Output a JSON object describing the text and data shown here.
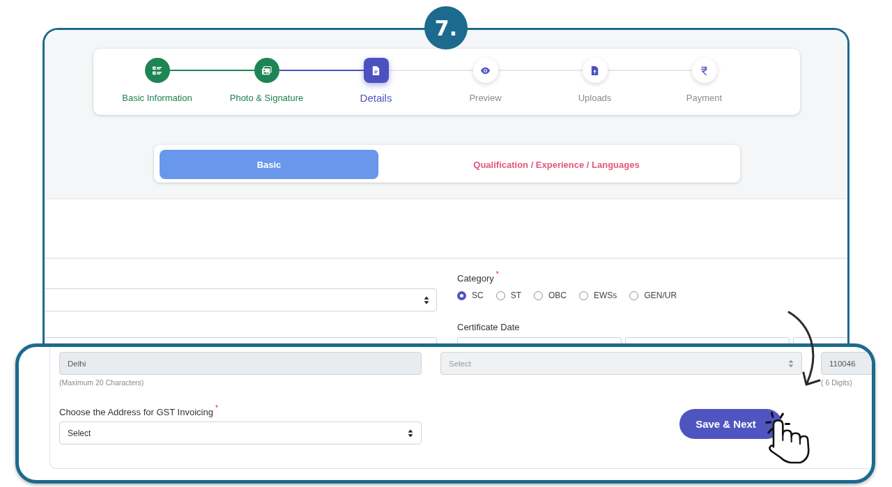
{
  "badge": {
    "label": "7."
  },
  "steps": [
    {
      "label": "Basic Information",
      "completed": true,
      "selected": false
    },
    {
      "label": "Photo & Signature",
      "completed": true,
      "selected": false
    },
    {
      "label": "Details",
      "completed": false,
      "selected": true
    },
    {
      "label": "Preview",
      "completed": false,
      "selected": false
    },
    {
      "label": "Uploads",
      "completed": false,
      "selected": false
    },
    {
      "label": "Payment",
      "completed": false,
      "selected": false
    }
  ],
  "tabs": [
    {
      "label": "Basic",
      "selected": true
    },
    {
      "label": "Qualification / Experience / Languages",
      "selected": false
    }
  ],
  "form": {
    "left_fields": [
      {
        "kind": "select"
      },
      {
        "kind": "input"
      }
    ],
    "category": {
      "label": "Category",
      "required_mark": "*",
      "options": [
        {
          "label": "SC",
          "selected": true
        },
        {
          "label": "ST",
          "selected": false
        },
        {
          "label": "OBC",
          "selected": false
        },
        {
          "label": "EWSs",
          "selected": false
        },
        {
          "label": "GEN/UR",
          "selected": false
        }
      ]
    },
    "certificate_date": {
      "label": "Certificate Date",
      "inputs": [
        {
          "kind": "input"
        },
        {
          "kind": "input"
        },
        {
          "kind": "input"
        }
      ]
    }
  },
  "zoom_panel": {
    "address_fields": [
      {
        "kind": "input",
        "value": "Delhi",
        "disabled": true,
        "hint": "(Maximum 20 Characters)"
      },
      {
        "kind": "select",
        "placeholder": "Select",
        "disabled": true
      },
      {
        "kind": "input",
        "value": "110046",
        "disabled": true,
        "hint": "( 6 Digits)"
      }
    ],
    "gst_address": {
      "label": "Choose the Address for GST Invoicing",
      "required_mark": "*",
      "kind": "select",
      "placeholder": "Select",
      "disabled": false
    },
    "save_button": {
      "label": "Save & Next"
    }
  }
}
